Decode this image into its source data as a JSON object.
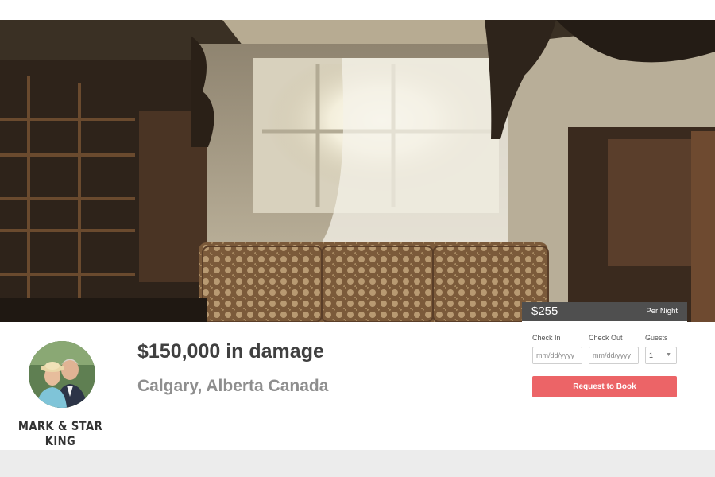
{
  "listing": {
    "title": "$150,000 in damage",
    "location": "Calgary, Alberta Canada"
  },
  "host": {
    "name": "MARK & STAR KING"
  },
  "booking": {
    "price": "$255",
    "price_unit": "Per Night",
    "check_in_label": "Check In",
    "check_in_placeholder": "mm/dd/yyyy",
    "check_out_label": "Check Out",
    "check_out_placeholder": "mm/dd/yyyy",
    "guests_label": "Guests",
    "guests_value": "1",
    "submit_label": "Request to Book"
  },
  "colors": {
    "accent": "#ec6467",
    "title_text": "#404040",
    "subtitle_text": "#8e8e8e",
    "footer_band": "#ececec"
  }
}
